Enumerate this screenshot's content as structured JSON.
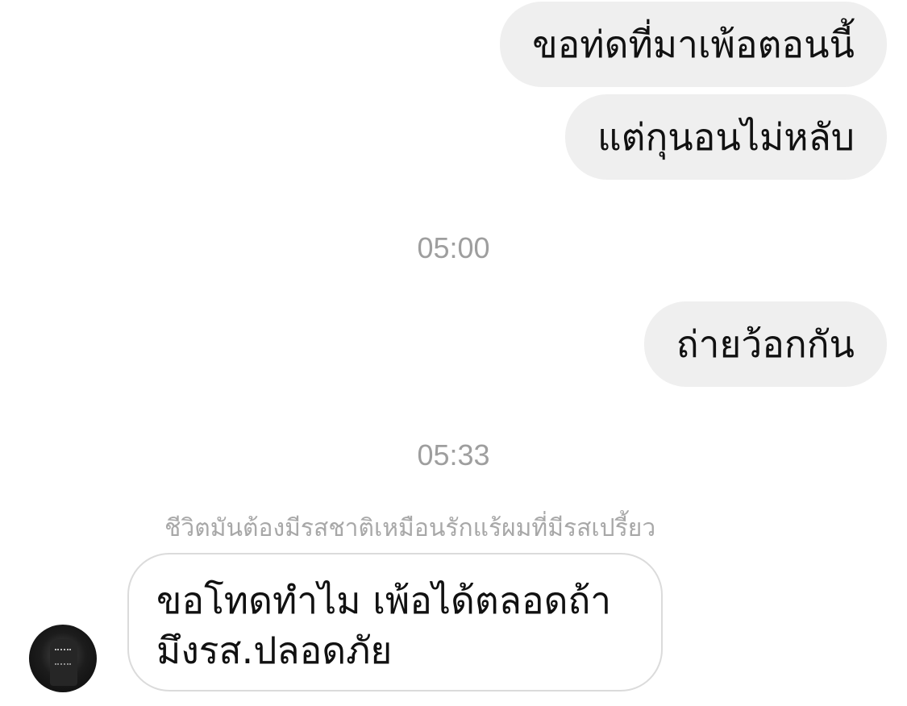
{
  "messages": {
    "outgoing_1": "ขอท่ดที่มาเพ้อตอนนี้",
    "outgoing_2": "แต่กุนอนไม่หลับ",
    "outgoing_3": "ถ่ายว้อกกัน",
    "incoming_1": "ขอโทดทำไม เพ้อได้ตลอดถ้ามึงรส.ปลอดภัย"
  },
  "timestamps": {
    "first": "05:00",
    "second": "05:33"
  },
  "sender": {
    "name": "ชีวิตมันต้องมีรสชาติเหมือนรักแร้ผมที่มีรสเปรี้ยว",
    "avatar_icon": "avatar-photo"
  },
  "colors": {
    "outgoing_bubble": "#efefef",
    "incoming_border": "#dbdbdb",
    "timestamp_text": "#9e9e9e",
    "sender_name_text": "#a8a8a8"
  }
}
